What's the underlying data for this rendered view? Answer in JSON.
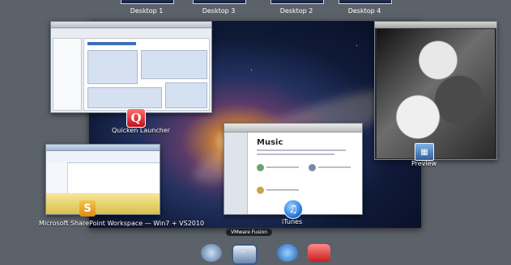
{
  "spaces": [
    {
      "label": "Desktop 1"
    },
    {
      "label": "Desktop 3"
    },
    {
      "label": "Desktop 2"
    },
    {
      "label": "Desktop 4"
    }
  ],
  "windows": {
    "quicken": {
      "caption": "Quicken Launcher",
      "icon": "Q"
    },
    "sharepoint": {
      "caption": "Microsoft SharePoint Workspace — Win7 + VS2010",
      "icon": "S"
    },
    "itunes": {
      "caption": "iTunes",
      "icon": "♫",
      "content_title": "Music"
    },
    "preview": {
      "caption": "Preview",
      "icon": "▦"
    }
  },
  "dock": {
    "tooltip": "VMware Fusion"
  },
  "colors": {
    "background": "#5a6068",
    "accent": "#3e6fb1"
  }
}
